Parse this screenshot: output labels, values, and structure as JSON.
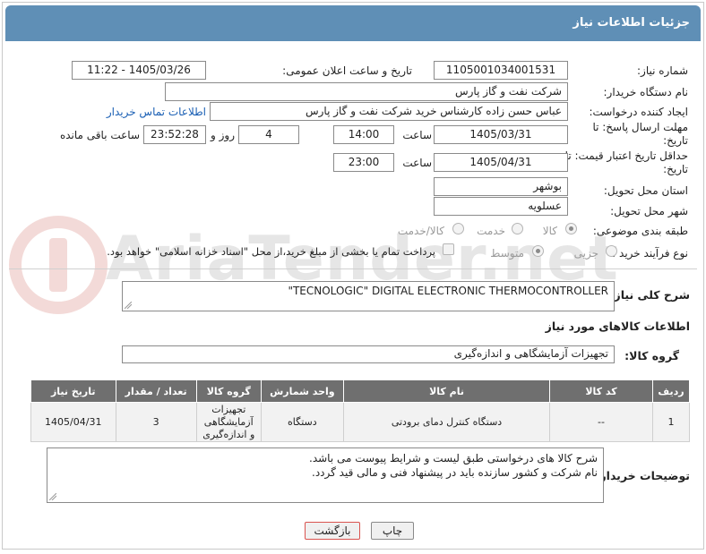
{
  "header": {
    "title": "جزئیات اطلاعات نیاز"
  },
  "fields": {
    "need_number_label": "شماره نیاز:",
    "need_number": "1105001034001531",
    "announce_label": "تاریخ و ساعت اعلان عمومی:",
    "announce_value": "1405/03/26 - 11:22",
    "buyer_org_label": "نام دستگاه خریدار:",
    "buyer_org": "شرکت نفت و گاز پارس",
    "creator_label": "ایجاد کننده درخواست:",
    "creator": "عباس حسن زاده کارشناس خرید شرکت نفت و گاز پارس",
    "contact_link": "اطلاعات تماس خریدار",
    "deadline_label": "مهلت ارسال پاسخ: تا تاریخ:",
    "deadline_date": "1405/03/31",
    "time_label": "ساعت",
    "deadline_time": "14:00",
    "days": "4",
    "days_label": "روز و",
    "remaining": "23:52:28",
    "remaining_label": "ساعت باقی مانده",
    "price_valid_label": "حداقل تاریخ اعتبار قیمت: تا تاریخ:",
    "price_valid_date": "1405/04/31",
    "price_valid_time": "23:00",
    "province_label": "استان محل تحویل:",
    "province": "بوشهر",
    "city_label": "شهر محل تحویل:",
    "city": "عسلویه",
    "category_label": "طبقه بندی موضوعی:",
    "category_options": [
      "کالا",
      "خدمت",
      "کالا/خدمت"
    ],
    "process_label": "نوع فرآیند خرید :",
    "process_options": [
      "جزیی",
      "متوسط"
    ],
    "payment_note": "پرداخت تمام یا بخشی از مبلغ خرید،از محل \"اسناد خزانه اسلامی\" خواهد بود."
  },
  "description": {
    "label": "شرح کلی نیاز:",
    "value": "\"TECNOLOGIC\" DIGITAL ELECTRONIC THERMOCONTROLLER"
  },
  "goods_section": {
    "title": "اطلاعات کالاهای مورد نیاز",
    "group_label": "گروه کالا:",
    "group_value": "تجهیزات آزمایشگاهی و اندازه‌گیری"
  },
  "table": {
    "headers": [
      "ردیف",
      "کد کالا",
      "نام کالا",
      "واحد شمارش",
      "گروه کالا",
      "تعداد / مقدار",
      "تاریخ نیاز"
    ],
    "rows": [
      [
        "1",
        "--",
        "دستگاه کنترل دمای برودتی",
        "دستگاه",
        "تجهیزات آزمایشگاهی و اندازه‌گیری",
        "3",
        "1405/04/31"
      ]
    ]
  },
  "buyer_notes": {
    "label": "توضیحات خریدار:",
    "line1": "شرح کالا های درخواستی طبق لیست و شرایط پیوست می باشد.",
    "line2": "نام شرکت و کشور سازنده باید در پیشنهاد فنی و مالی قید گردد."
  },
  "buttons": {
    "print": "چاپ",
    "back": "بازگشت"
  },
  "watermark": {
    "text": "AriaTender.net"
  },
  "colors": {
    "header": "#5f8fb6",
    "table_header": "#6f6f6f",
    "link": "#1a5fb4",
    "back_button_border": "#d9534f"
  }
}
